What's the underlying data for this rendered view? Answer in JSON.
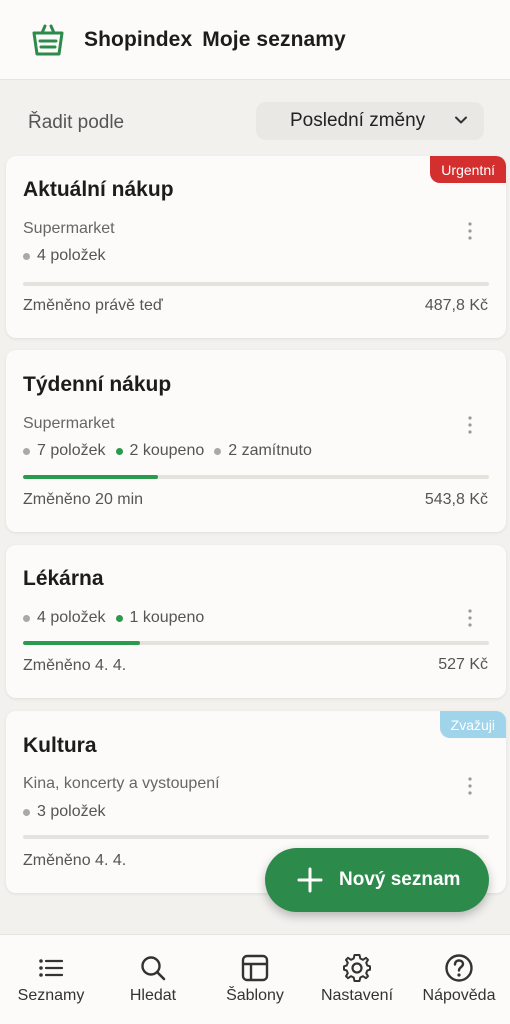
{
  "header": {
    "brand": "Shopindex",
    "title": "Moje seznamy",
    "logo_icon": "shopping-bag-icon"
  },
  "sort": {
    "label": "Řadit podle",
    "selected": "Poslední změny"
  },
  "colors": {
    "accent": "#2c8a4a",
    "urgent": "#d42f2f",
    "considering": "#9fd4ea",
    "progress": "#2a9a4f"
  },
  "lists": [
    {
      "title": "Aktuální nákup",
      "store": "Supermarket",
      "badge": "Urgentní",
      "meta": [
        {
          "text": "4 položek",
          "dot": "gray"
        }
      ],
      "progress": 0,
      "changed": "Změněno právě teď",
      "price": "487,8 Kč"
    },
    {
      "title": "Týdenní nákup",
      "store": "Supermarket",
      "badge": "",
      "meta": [
        {
          "text": "7 položek",
          "dot": "gray"
        },
        {
          "text": "2 koupeno",
          "dot": "green"
        },
        {
          "text": "2 zamítnuto",
          "dot": "gray"
        }
      ],
      "progress": 0.29,
      "changed": "Změněno 20 min",
      "price": "543,8 Kč"
    },
    {
      "title": "Lékárna",
      "store": "",
      "badge": "",
      "meta": [
        {
          "text": "4 položek",
          "dot": "gray"
        },
        {
          "text": "1 koupeno",
          "dot": "green"
        }
      ],
      "progress": 0.25,
      "changed": "Změněno 4. 4.",
      "price": "527 Kč"
    },
    {
      "title": "Kultura",
      "store": "Kina, koncerty a vystoupení",
      "badge": "Zvažuji",
      "meta": [
        {
          "text": "3 položek",
          "dot": "gray"
        }
      ],
      "progress": 0,
      "changed": "Změněno 4. 4.",
      "price": ""
    }
  ],
  "fab": {
    "label": "Nový seznam",
    "icon": "plus-icon"
  },
  "nav": [
    {
      "label": "Seznamy",
      "icon": "list-icon"
    },
    {
      "label": "Hledat",
      "icon": "search-icon"
    },
    {
      "label": "Šablony",
      "icon": "template-icon"
    },
    {
      "label": "Nastavení",
      "icon": "gear-icon"
    },
    {
      "label": "Nápověda",
      "icon": "help-icon"
    }
  ]
}
